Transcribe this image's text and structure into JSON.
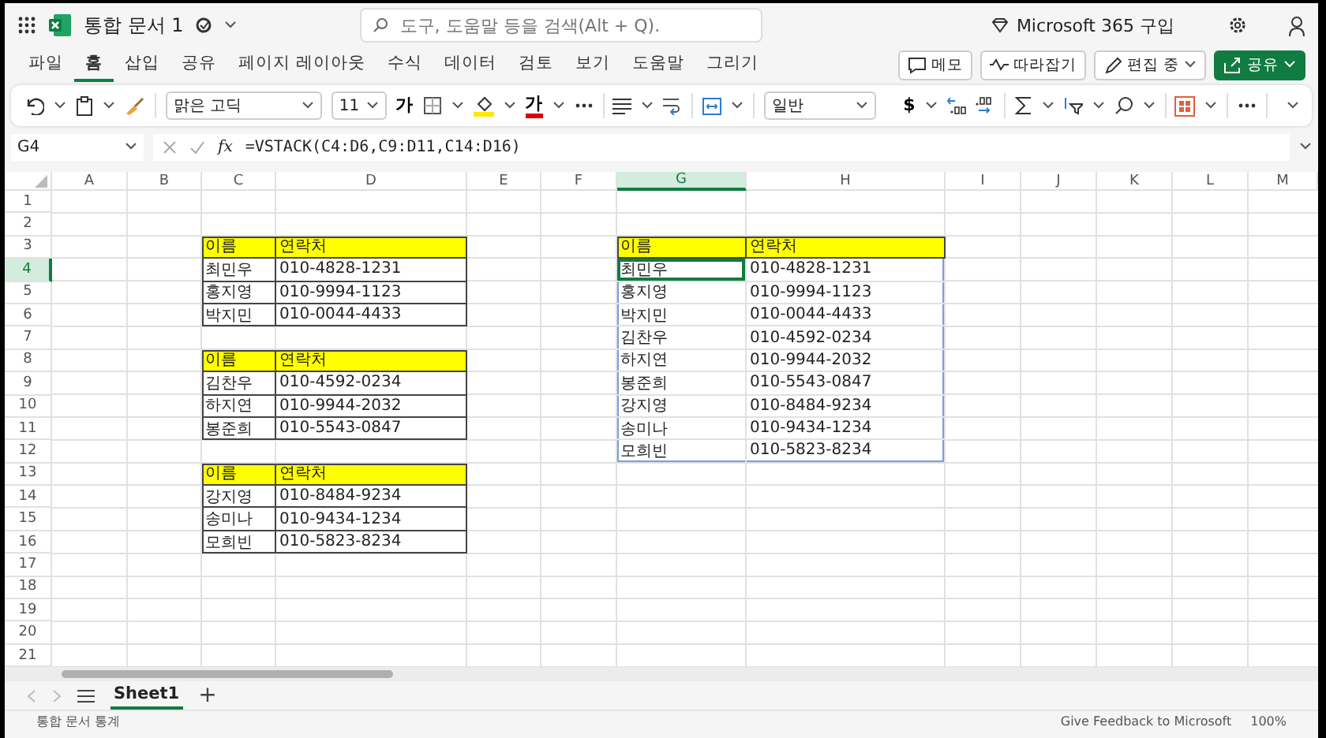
{
  "title_bar": {
    "document_title": "통합 문서 1",
    "search": {
      "placeholder": "도구, 도움말 등을 검색(Alt + Q)."
    },
    "purchase_link": "Microsoft 365 구입"
  },
  "menu_tabs": [
    {
      "label": "파일",
      "selected": false
    },
    {
      "label": "홈",
      "selected": true
    },
    {
      "label": "삽입",
      "selected": false
    },
    {
      "label": "공유",
      "selected": false
    },
    {
      "label": "페이지 레이아웃",
      "selected": false
    },
    {
      "label": "수식",
      "selected": false
    },
    {
      "label": "데이터",
      "selected": false
    },
    {
      "label": "검토",
      "selected": false
    },
    {
      "label": "보기",
      "selected": false
    },
    {
      "label": "도움말",
      "selected": false
    },
    {
      "label": "그리기",
      "selected": false
    }
  ],
  "menu_buttons": [
    {
      "label": "메모",
      "kind": "comment"
    },
    {
      "label": "따라잡기",
      "kind": "catchup"
    },
    {
      "label": "편집 중",
      "kind": "editing"
    },
    {
      "label": "공유",
      "kind": "share"
    }
  ],
  "ribbon": {
    "font_name": "맑은 고딕",
    "font_size": "11",
    "bold_glyph": "가",
    "font_color_glyph": "가",
    "number_format": "일반",
    "currency_glyph": "$"
  },
  "formula_bar": {
    "name_box": "G4",
    "fx": "fx",
    "formula": "=VSTACK(C4:D6,C9:D11,C14:D16)"
  },
  "columns": [
    {
      "label": "A",
      "selected": false
    },
    {
      "label": "B",
      "selected": false
    },
    {
      "label": "C",
      "selected": false
    },
    {
      "label": "D",
      "selected": false
    },
    {
      "label": "E",
      "selected": false
    },
    {
      "label": "F",
      "selected": false
    },
    {
      "label": "G",
      "selected": true
    },
    {
      "label": "H",
      "selected": false
    },
    {
      "label": "I",
      "selected": false
    },
    {
      "label": "J",
      "selected": false
    },
    {
      "label": "K",
      "selected": false
    },
    {
      "label": "L",
      "selected": false
    },
    {
      "label": "M",
      "selected": false
    }
  ],
  "rows": [
    {
      "number": "1",
      "selected": false
    },
    {
      "number": "2",
      "selected": false
    },
    {
      "number": "3",
      "selected": false,
      "cells": [
        {
          "kind": "blank"
        },
        {
          "kind": "blank"
        },
        {
          "text": "이름",
          "kind": "header",
          "selected": false
        },
        {
          "text": "연락처",
          "kind": "header",
          "selected": false
        },
        {
          "kind": "blank"
        },
        {
          "kind": "blank"
        },
        {
          "text": "이름",
          "kind": "header",
          "selected": false
        },
        {
          "text": "연락처",
          "kind": "header",
          "selected": false
        }
      ]
    },
    {
      "number": "4",
      "selected": true,
      "cells": [
        {
          "kind": "blank"
        },
        {
          "kind": "blank"
        },
        {
          "text": "최민우",
          "kind": "bordered",
          "selected": false
        },
        {
          "text": "010-4828-1231",
          "kind": "bordered",
          "selected": false
        },
        {
          "kind": "blank"
        },
        {
          "kind": "blank"
        },
        {
          "text": "최민우",
          "kind": "spill",
          "selected": true
        },
        {
          "text": "010-4828-1231",
          "kind": "spill",
          "selected": false
        }
      ]
    },
    {
      "number": "5",
      "selected": false,
      "cells": [
        {
          "kind": "blank"
        },
        {
          "kind": "blank"
        },
        {
          "text": "홍지영",
          "kind": "bordered",
          "selected": false
        },
        {
          "text": "010-9994-1123",
          "kind": "bordered",
          "selected": false
        },
        {
          "kind": "blank"
        },
        {
          "kind": "blank"
        },
        {
          "text": "홍지영",
          "kind": "spill",
          "selected": false
        },
        {
          "text": "010-9994-1123",
          "kind": "spill",
          "selected": false
        }
      ]
    },
    {
      "number": "6",
      "selected": false,
      "cells": [
        {
          "kind": "blank"
        },
        {
          "kind": "blank"
        },
        {
          "text": "박지민",
          "kind": "bordered",
          "selected": false
        },
        {
          "text": "010-0044-4433",
          "kind": "bordered",
          "selected": false
        },
        {
          "kind": "blank"
        },
        {
          "kind": "blank"
        },
        {
          "text": "박지민",
          "kind": "spill",
          "selected": false
        },
        {
          "text": "010-0044-4433",
          "kind": "spill",
          "selected": false
        }
      ]
    },
    {
      "number": "7",
      "selected": false,
      "cells": [
        {
          "kind": "blank"
        },
        {
          "kind": "blank"
        },
        {
          "kind": "blank"
        },
        {
          "kind": "blank"
        },
        {
          "kind": "blank"
        },
        {
          "kind": "blank"
        },
        {
          "text": "김찬우",
          "kind": "spill",
          "selected": false
        },
        {
          "text": "010-4592-0234",
          "kind": "spill",
          "selected": false
        }
      ]
    },
    {
      "number": "8",
      "selected": false,
      "cells": [
        {
          "kind": "blank"
        },
        {
          "kind": "blank"
        },
        {
          "text": "이름",
          "kind": "header",
          "selected": false
        },
        {
          "text": "연락처",
          "kind": "header",
          "selected": false
        },
        {
          "kind": "blank"
        },
        {
          "kind": "blank"
        },
        {
          "text": "하지연",
          "kind": "spill",
          "selected": false
        },
        {
          "text": "010-9944-2032",
          "kind": "spill",
          "selected": false
        }
      ]
    },
    {
      "number": "9",
      "selected": false,
      "cells": [
        {
          "kind": "blank"
        },
        {
          "kind": "blank"
        },
        {
          "text": "김찬우",
          "kind": "bordered",
          "selected": false
        },
        {
          "text": "010-4592-0234",
          "kind": "bordered",
          "selected": false
        },
        {
          "kind": "blank"
        },
        {
          "kind": "blank"
        },
        {
          "text": "봉준희",
          "kind": "spill",
          "selected": false
        },
        {
          "text": "010-5543-0847",
          "kind": "spill",
          "selected": false
        }
      ]
    },
    {
      "number": "10",
      "selected": false,
      "cells": [
        {
          "kind": "blank"
        },
        {
          "kind": "blank"
        },
        {
          "text": "하지연",
          "kind": "bordered",
          "selected": false
        },
        {
          "text": "010-9944-2032",
          "kind": "bordered",
          "selected": false
        },
        {
          "kind": "blank"
        },
        {
          "kind": "blank"
        },
        {
          "text": "강지영",
          "kind": "spill",
          "selected": false
        },
        {
          "text": "010-8484-9234",
          "kind": "spill",
          "selected": false
        }
      ]
    },
    {
      "number": "11",
      "selected": false,
      "cells": [
        {
          "kind": "blank"
        },
        {
          "kind": "blank"
        },
        {
          "text": "봉준희",
          "kind": "bordered",
          "selected": false
        },
        {
          "text": "010-5543-0847",
          "kind": "bordered",
          "selected": false
        },
        {
          "kind": "blank"
        },
        {
          "kind": "blank"
        },
        {
          "text": "송미나",
          "kind": "spill",
          "selected": false
        },
        {
          "text": "010-9434-1234",
          "kind": "spill",
          "selected": false
        }
      ]
    },
    {
      "number": "12",
      "selected": false,
      "cells": [
        {
          "kind": "blank"
        },
        {
          "kind": "blank"
        },
        {
          "kind": "blank"
        },
        {
          "kind": "blank"
        },
        {
          "kind": "blank"
        },
        {
          "kind": "blank"
        },
        {
          "text": "모희빈",
          "kind": "spill",
          "selected": false
        },
        {
          "text": "010-5823-8234",
          "kind": "spill",
          "selected": false
        }
      ]
    },
    {
      "number": "13",
      "selected": false,
      "cells": [
        {
          "kind": "blank"
        },
        {
          "kind": "blank"
        },
        {
          "text": "이름",
          "kind": "header",
          "selected": false
        },
        {
          "text": "연락처",
          "kind": "header",
          "selected": false
        }
      ]
    },
    {
      "number": "14",
      "selected": false,
      "cells": [
        {
          "kind": "blank"
        },
        {
          "kind": "blank"
        },
        {
          "text": "강지영",
          "kind": "bordered",
          "selected": false
        },
        {
          "text": "010-8484-9234",
          "kind": "bordered",
          "selected": false
        }
      ]
    },
    {
      "number": "15",
      "selected": false,
      "cells": [
        {
          "kind": "blank"
        },
        {
          "kind": "blank"
        },
        {
          "text": "송미나",
          "kind": "bordered",
          "selected": false
        },
        {
          "text": "010-9434-1234",
          "kind": "bordered",
          "selected": false
        }
      ]
    },
    {
      "number": "16",
      "selected": false,
      "cells": [
        {
          "kind": "blank"
        },
        {
          "kind": "blank"
        },
        {
          "text": "모희빈",
          "kind": "bordered",
          "selected": false
        },
        {
          "text": "010-5823-8234",
          "kind": "bordered",
          "selected": false
        }
      ]
    },
    {
      "number": "17",
      "selected": false
    },
    {
      "number": "18",
      "selected": false
    },
    {
      "number": "19",
      "selected": false
    },
    {
      "number": "20",
      "selected": false
    },
    {
      "number": "21",
      "selected": false
    }
  ],
  "sheet_tabs": [
    {
      "label": "Sheet1",
      "selected": true
    }
  ],
  "add_sheet": "+",
  "status_bar": {
    "statistics": "통합 문서 통계",
    "feedback": "Give Feedback to Microsoft",
    "zoom": "100%"
  }
}
